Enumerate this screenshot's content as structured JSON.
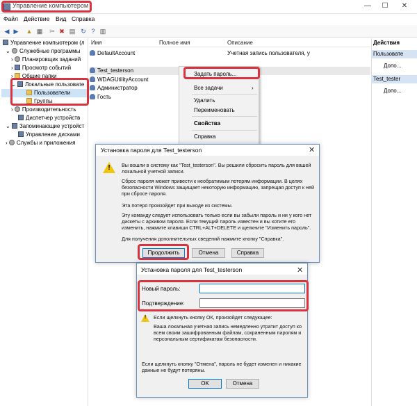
{
  "window": {
    "title": "Управление компьютером"
  },
  "menu": [
    "Файл",
    "Действие",
    "Вид",
    "Справка"
  ],
  "tree": [
    "Управление компьютером (л",
    "Служебные программы",
    "Планировщик заданий",
    "Просмотр событий",
    "Общие папки",
    "Локальные пользовате",
    "Пользователи",
    "Группы",
    "Производительность",
    "Диспетчер устройств",
    "Запоминающие устройст",
    "Управление дисками",
    "Службы и приложения"
  ],
  "list": {
    "columns": [
      "Имя",
      "Полное имя",
      "Описание"
    ],
    "rows": [
      {
        "name": "DefaultAccount",
        "desc": "Учетная запись пользователя, у"
      },
      {
        "name": "Test_testerson",
        "desc": ""
      },
      {
        "name": "WDAGUtilityAccount",
        "desc": ""
      },
      {
        "name": "Администратор",
        "desc": ""
      },
      {
        "name": "Гость",
        "desc": ""
      }
    ]
  },
  "actions": {
    "header": "Действия",
    "sec1": "Пользовате",
    "more1": "Допо...",
    "sec2": "Test_tester",
    "more2": "Допо..."
  },
  "context_menu": {
    "set_password": "Задать пароль...",
    "all_tasks": "Все задачи",
    "delete": "Удалить",
    "rename": "Переименовать",
    "properties": "Свойства",
    "help": "Справка"
  },
  "dialog1": {
    "title": "Установка пароля для Test_testerson",
    "p1": "Вы вошли в систему как \"Test_testerson\". Вы решили сбросить пароль для вашей локальной учетной записи.",
    "p2": "Сброс пароля может привести к необратимым потерям информации. В целях безопасности Windows защищает некоторую информацию, запрещая доступ к ней при сбросе пароля.",
    "p3": "Эта потеря произойдет при выходе из системы.",
    "p4": "Эту команду следует использовать только если вы забыли пароль и ни у кого нет дискеты с архивом пароля. Если текущий пароль известен и вы хотите его изменить, нажмите клавиши CTRL+ALT+DELETE и щелкните \"Изменить пароль\".",
    "p5": "Для получения дополнительных сведений нажмите кнопку \"Справка\".",
    "continue": "Продолжить",
    "cancel": "Отмена",
    "help": "Справка"
  },
  "dialog2": {
    "title": "Установка пароля для Test_testerson",
    "new_password_label": "Новый пароль:",
    "new_password_value": "",
    "confirm_label": "Подтверждение:",
    "confirm_value": "",
    "warn_head": "Если щелкнуть кнопку ОК, произойдет следующее:",
    "warn_body": "Ваша локальная учетная запись немедленно утратит доступ ко всем своим зашифрованным файлам, сохраненным паролям и персональным сертификатам безопасности.",
    "cancel_note": "Если щелкнуть кнопку \"Отмена\", пароль не будет изменен и никакие данные не будут потеряны.",
    "ok": "OK",
    "cancel": "Отмена"
  },
  "highlight_color": "#d9333f"
}
